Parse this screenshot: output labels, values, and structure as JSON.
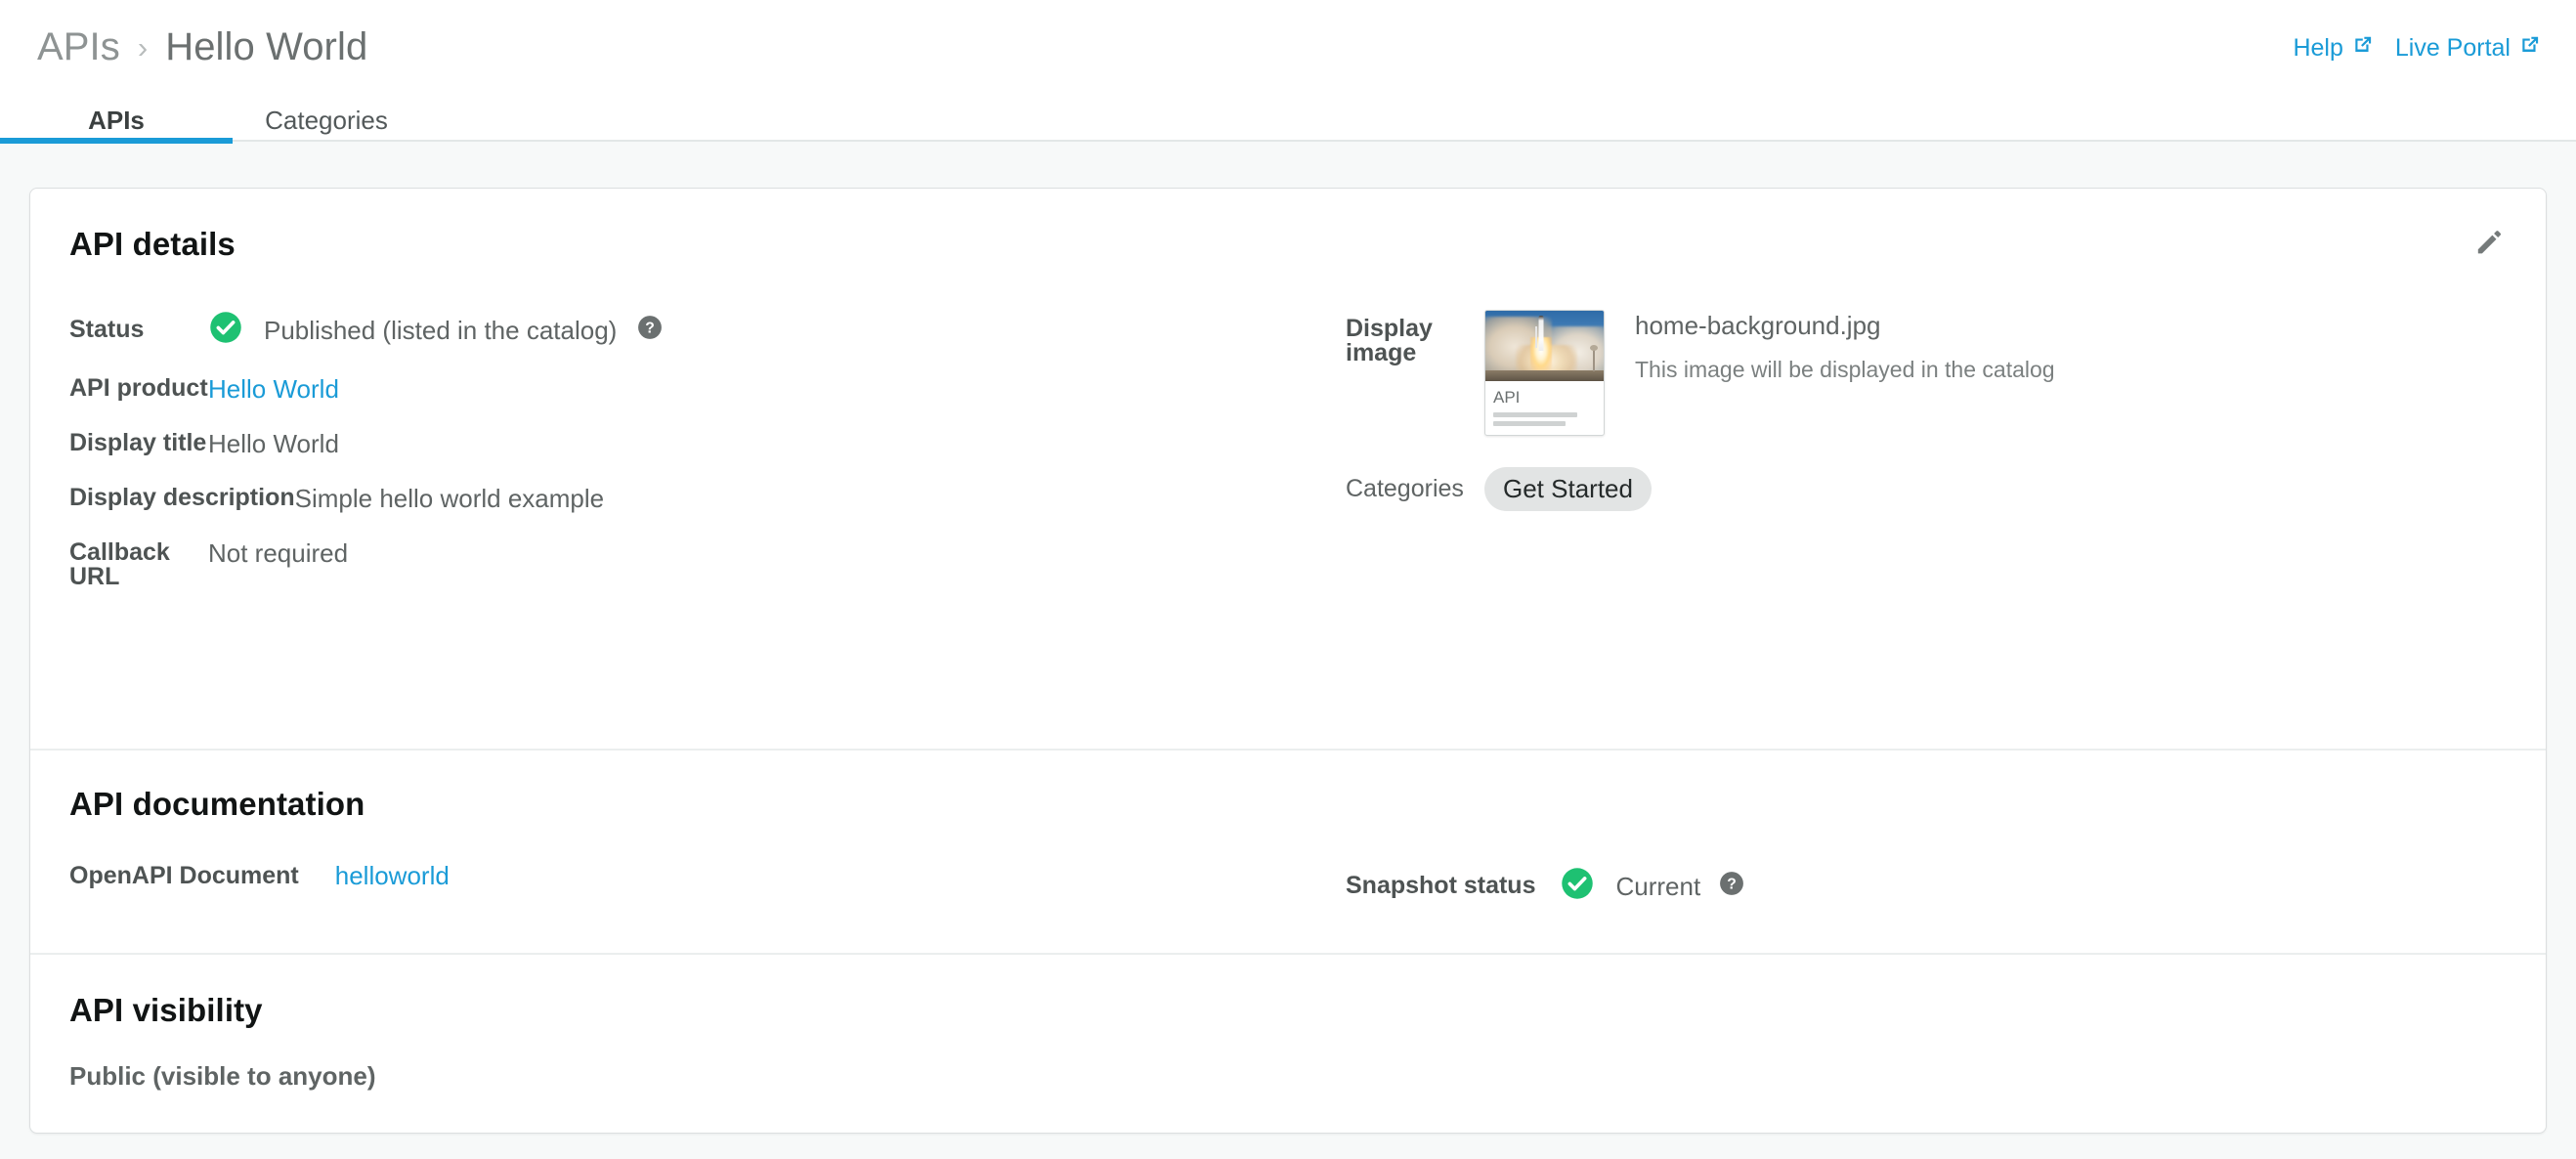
{
  "header": {
    "breadcrumb": {
      "root": "APIs",
      "separator": "›",
      "current": "Hello World"
    },
    "links": [
      {
        "label": "Help",
        "icon": "external-link-icon"
      },
      {
        "label": "Live Portal",
        "icon": "external-link-icon"
      }
    ]
  },
  "tabs": [
    {
      "label": "APIs",
      "active": true
    },
    {
      "label": "Categories",
      "active": false
    }
  ],
  "sections": {
    "details": {
      "title": "API details",
      "edit_icon": "pencil-icon",
      "status": {
        "label": "Status",
        "icon": "check-circle-icon",
        "value": "Published (listed in the catalog)",
        "help_icon": "help-circle-icon"
      },
      "api_product": {
        "label": "API product",
        "value": "Hello World"
      },
      "display_title": {
        "label": "Display title",
        "value": "Hello World"
      },
      "display_description": {
        "label": "Display description",
        "value": "Simple hello world example"
      },
      "callback_url": {
        "label": "Callback URL",
        "value": "Not required"
      },
      "display_image": {
        "label": "Display image",
        "thumbnail_caption": "API",
        "file_name": "home-background.jpg",
        "hint": "This image will be displayed in the catalog"
      },
      "categories": {
        "label": "Categories",
        "chips": [
          "Get Started"
        ]
      }
    },
    "documentation": {
      "title": "API documentation",
      "openapi": {
        "label": "OpenAPI Document",
        "value": "helloworld"
      },
      "snapshot": {
        "label": "Snapshot status",
        "icon": "check-circle-icon",
        "value": "Current",
        "help_icon": "help-circle-icon"
      }
    },
    "visibility": {
      "title": "API visibility",
      "value": "Public (visible to anyone)"
    }
  },
  "colors": {
    "link": "#1a9bd7",
    "accent_tab": "#1a9bd7",
    "success": "#1ec172",
    "page_bg": "#f7f9f9",
    "card_bg": "#ffffff",
    "help_icon": "#6b7070",
    "chip_bg": "#e2e4e4"
  }
}
